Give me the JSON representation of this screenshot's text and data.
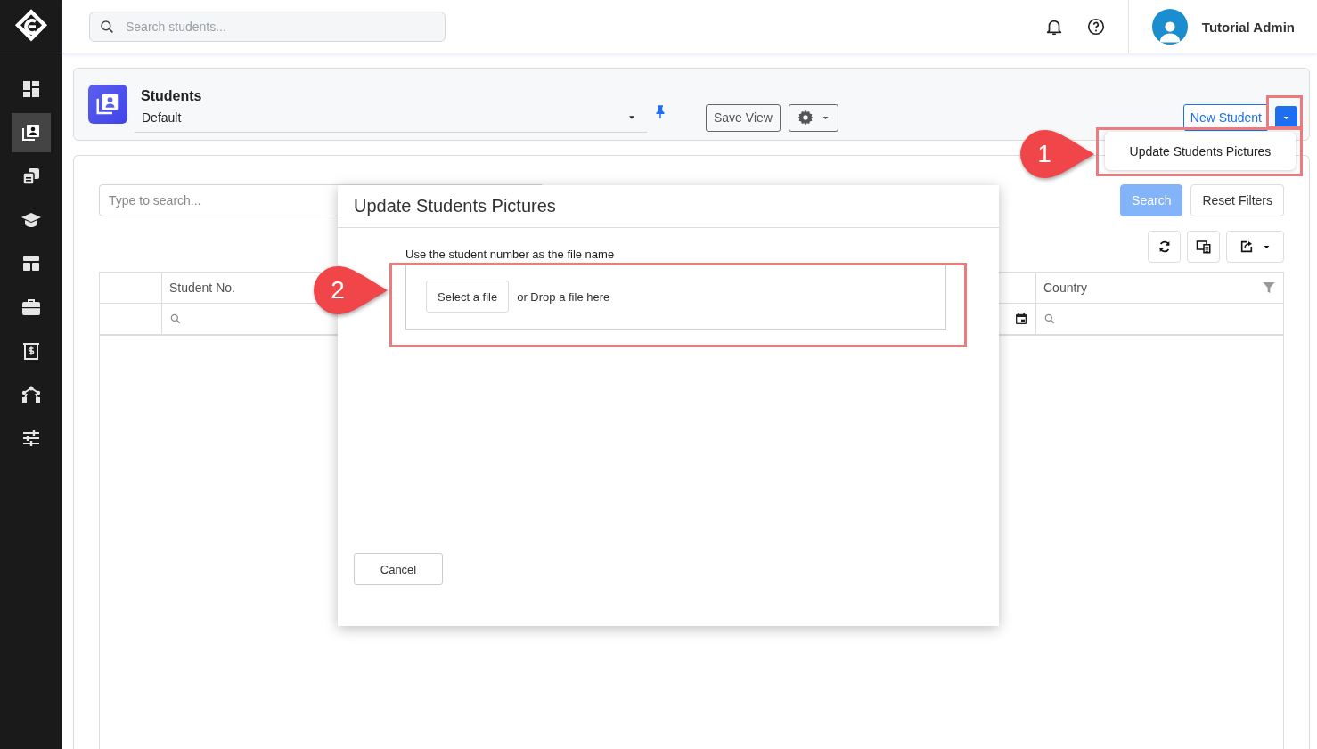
{
  "sidebar": {
    "items": [
      {
        "kind": "dashboard",
        "selected": false
      },
      {
        "kind": "contacts",
        "selected": true
      },
      {
        "kind": "documents",
        "selected": false
      },
      {
        "kind": "graduation",
        "selected": false
      },
      {
        "kind": "layout",
        "selected": false
      },
      {
        "kind": "briefcase",
        "selected": false
      },
      {
        "kind": "invoice",
        "selected": false
      },
      {
        "kind": "network",
        "selected": false
      },
      {
        "kind": "sliders",
        "selected": false
      }
    ]
  },
  "topbar": {
    "search": {
      "placeholder": "Search students..."
    },
    "user": {
      "name": "Tutorial Admin"
    }
  },
  "header": {
    "title": "Students",
    "view": "Default",
    "save_view": "Save View",
    "new_button": "New Student"
  },
  "dropdown_menu": {
    "items": [
      "Update Students Pictures"
    ]
  },
  "filters": {
    "search": {
      "placeholder": "Type to search..."
    },
    "buttons": [
      {
        "label": "Search",
        "disabled": true
      },
      {
        "label": "Reset Filters",
        "disabled": false
      }
    ]
  },
  "table": {
    "columns": [
      {
        "kind": "plain"
      },
      {
        "label": "Student No.",
        "kind": "search"
      },
      {
        "kind": "date"
      },
      {
        "label": "Country",
        "kind": "search",
        "funnel": true
      }
    ]
  },
  "dialog": {
    "title": "Update Students Pictures",
    "hint": "Use the student number as the file name",
    "select_button": "Select a file",
    "drop_text": "or Drop a file here",
    "cancel": "Cancel"
  },
  "annotations": [
    {
      "label": "1"
    },
    {
      "label": "2"
    }
  ]
}
